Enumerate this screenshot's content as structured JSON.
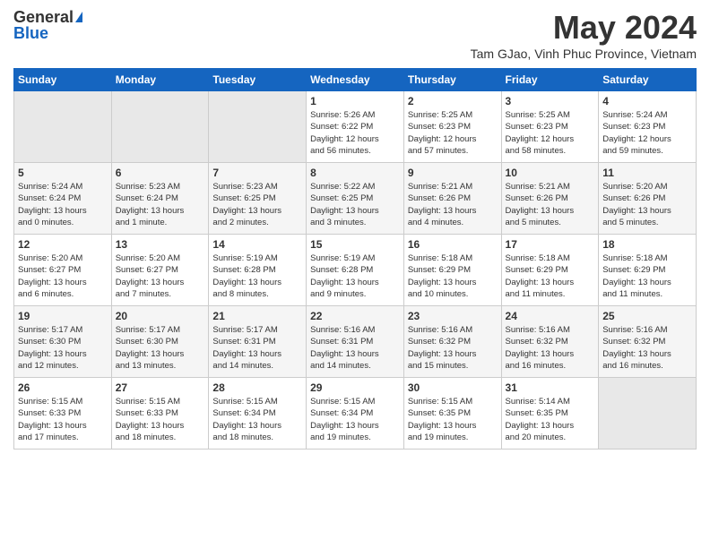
{
  "header": {
    "logo_general": "General",
    "logo_blue": "Blue",
    "title": "May 2024",
    "location": "Tam GJao, Vinh Phuc Province, Vietnam"
  },
  "days_of_week": [
    "Sunday",
    "Monday",
    "Tuesday",
    "Wednesday",
    "Thursday",
    "Friday",
    "Saturday"
  ],
  "weeks": [
    [
      {
        "day": "",
        "info": ""
      },
      {
        "day": "",
        "info": ""
      },
      {
        "day": "",
        "info": ""
      },
      {
        "day": "1",
        "info": "Sunrise: 5:26 AM\nSunset: 6:22 PM\nDaylight: 12 hours\nand 56 minutes."
      },
      {
        "day": "2",
        "info": "Sunrise: 5:25 AM\nSunset: 6:23 PM\nDaylight: 12 hours\nand 57 minutes."
      },
      {
        "day": "3",
        "info": "Sunrise: 5:25 AM\nSunset: 6:23 PM\nDaylight: 12 hours\nand 58 minutes."
      },
      {
        "day": "4",
        "info": "Sunrise: 5:24 AM\nSunset: 6:23 PM\nDaylight: 12 hours\nand 59 minutes."
      }
    ],
    [
      {
        "day": "5",
        "info": "Sunrise: 5:24 AM\nSunset: 6:24 PM\nDaylight: 13 hours\nand 0 minutes."
      },
      {
        "day": "6",
        "info": "Sunrise: 5:23 AM\nSunset: 6:24 PM\nDaylight: 13 hours\nand 1 minute."
      },
      {
        "day": "7",
        "info": "Sunrise: 5:23 AM\nSunset: 6:25 PM\nDaylight: 13 hours\nand 2 minutes."
      },
      {
        "day": "8",
        "info": "Sunrise: 5:22 AM\nSunset: 6:25 PM\nDaylight: 13 hours\nand 3 minutes."
      },
      {
        "day": "9",
        "info": "Sunrise: 5:21 AM\nSunset: 6:26 PM\nDaylight: 13 hours\nand 4 minutes."
      },
      {
        "day": "10",
        "info": "Sunrise: 5:21 AM\nSunset: 6:26 PM\nDaylight: 13 hours\nand 5 minutes."
      },
      {
        "day": "11",
        "info": "Sunrise: 5:20 AM\nSunset: 6:26 PM\nDaylight: 13 hours\nand 5 minutes."
      }
    ],
    [
      {
        "day": "12",
        "info": "Sunrise: 5:20 AM\nSunset: 6:27 PM\nDaylight: 13 hours\nand 6 minutes."
      },
      {
        "day": "13",
        "info": "Sunrise: 5:20 AM\nSunset: 6:27 PM\nDaylight: 13 hours\nand 7 minutes."
      },
      {
        "day": "14",
        "info": "Sunrise: 5:19 AM\nSunset: 6:28 PM\nDaylight: 13 hours\nand 8 minutes."
      },
      {
        "day": "15",
        "info": "Sunrise: 5:19 AM\nSunset: 6:28 PM\nDaylight: 13 hours\nand 9 minutes."
      },
      {
        "day": "16",
        "info": "Sunrise: 5:18 AM\nSunset: 6:29 PM\nDaylight: 13 hours\nand 10 minutes."
      },
      {
        "day": "17",
        "info": "Sunrise: 5:18 AM\nSunset: 6:29 PM\nDaylight: 13 hours\nand 11 minutes."
      },
      {
        "day": "18",
        "info": "Sunrise: 5:18 AM\nSunset: 6:29 PM\nDaylight: 13 hours\nand 11 minutes."
      }
    ],
    [
      {
        "day": "19",
        "info": "Sunrise: 5:17 AM\nSunset: 6:30 PM\nDaylight: 13 hours\nand 12 minutes."
      },
      {
        "day": "20",
        "info": "Sunrise: 5:17 AM\nSunset: 6:30 PM\nDaylight: 13 hours\nand 13 minutes."
      },
      {
        "day": "21",
        "info": "Sunrise: 5:17 AM\nSunset: 6:31 PM\nDaylight: 13 hours\nand 14 minutes."
      },
      {
        "day": "22",
        "info": "Sunrise: 5:16 AM\nSunset: 6:31 PM\nDaylight: 13 hours\nand 14 minutes."
      },
      {
        "day": "23",
        "info": "Sunrise: 5:16 AM\nSunset: 6:32 PM\nDaylight: 13 hours\nand 15 minutes."
      },
      {
        "day": "24",
        "info": "Sunrise: 5:16 AM\nSunset: 6:32 PM\nDaylight: 13 hours\nand 16 minutes."
      },
      {
        "day": "25",
        "info": "Sunrise: 5:16 AM\nSunset: 6:32 PM\nDaylight: 13 hours\nand 16 minutes."
      }
    ],
    [
      {
        "day": "26",
        "info": "Sunrise: 5:15 AM\nSunset: 6:33 PM\nDaylight: 13 hours\nand 17 minutes."
      },
      {
        "day": "27",
        "info": "Sunrise: 5:15 AM\nSunset: 6:33 PM\nDaylight: 13 hours\nand 18 minutes."
      },
      {
        "day": "28",
        "info": "Sunrise: 5:15 AM\nSunset: 6:34 PM\nDaylight: 13 hours\nand 18 minutes."
      },
      {
        "day": "29",
        "info": "Sunrise: 5:15 AM\nSunset: 6:34 PM\nDaylight: 13 hours\nand 19 minutes."
      },
      {
        "day": "30",
        "info": "Sunrise: 5:15 AM\nSunset: 6:35 PM\nDaylight: 13 hours\nand 19 minutes."
      },
      {
        "day": "31",
        "info": "Sunrise: 5:14 AM\nSunset: 6:35 PM\nDaylight: 13 hours\nand 20 minutes."
      },
      {
        "day": "",
        "info": ""
      }
    ]
  ]
}
